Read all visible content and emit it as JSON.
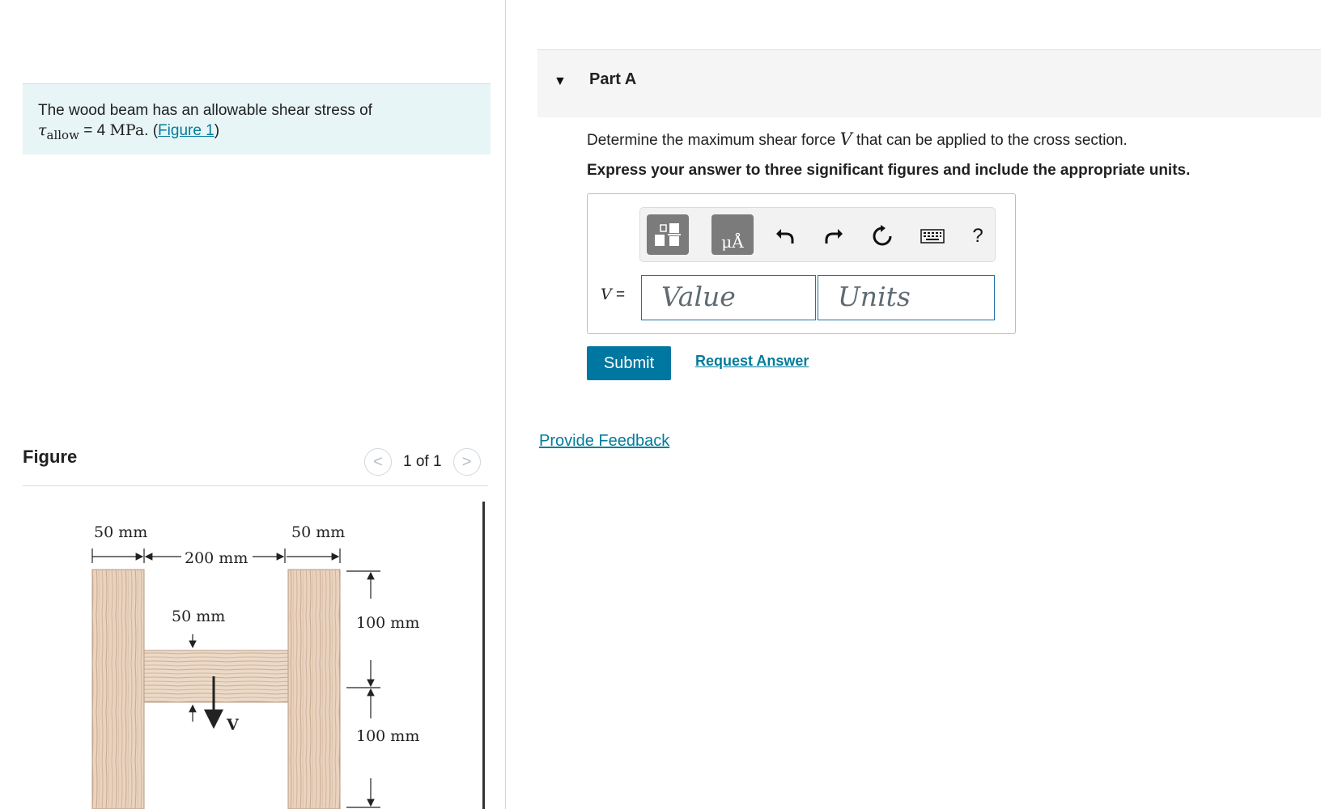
{
  "problem": {
    "intro": "The wood beam has an allowable shear stress of",
    "symbol": "τ",
    "subscript": "allow",
    "equals": " = 4 ",
    "unit": "MPa",
    "period": ". (",
    "figure_link": "Figure 1",
    "close": ")"
  },
  "figure_panel": {
    "title": "Figure",
    "pager_text": "1 of 1",
    "prev_symbol": "<",
    "next_symbol": ">",
    "dims": {
      "top_left": "50 mm",
      "top_right": "50 mm",
      "middle": "200 mm",
      "web": "50 mm",
      "upper_height": "100 mm",
      "lower_height": "100 mm",
      "force": "V"
    }
  },
  "part": {
    "caret": "▼",
    "title": "Part A",
    "question_before": "Determine the maximum shear force ",
    "question_var": "V",
    "question_after": " that can be applied to the cross section.",
    "instruction": "Express your answer to three significant figures and include the appropriate units.",
    "var_symbol": "V",
    "var_eq": " =",
    "value_placeholder": "Value",
    "units_placeholder": "Units",
    "units_button_text": "μÅ",
    "help_symbol": "?",
    "submit_label": "Submit",
    "request_label": "Request Answer",
    "feedback_label": "Provide Feedback"
  },
  "colors": {
    "accent": "#0077a0",
    "link": "#007c9b",
    "problem_bg": "#e8f5f7",
    "toolbar_button": "#7b7b7b"
  }
}
